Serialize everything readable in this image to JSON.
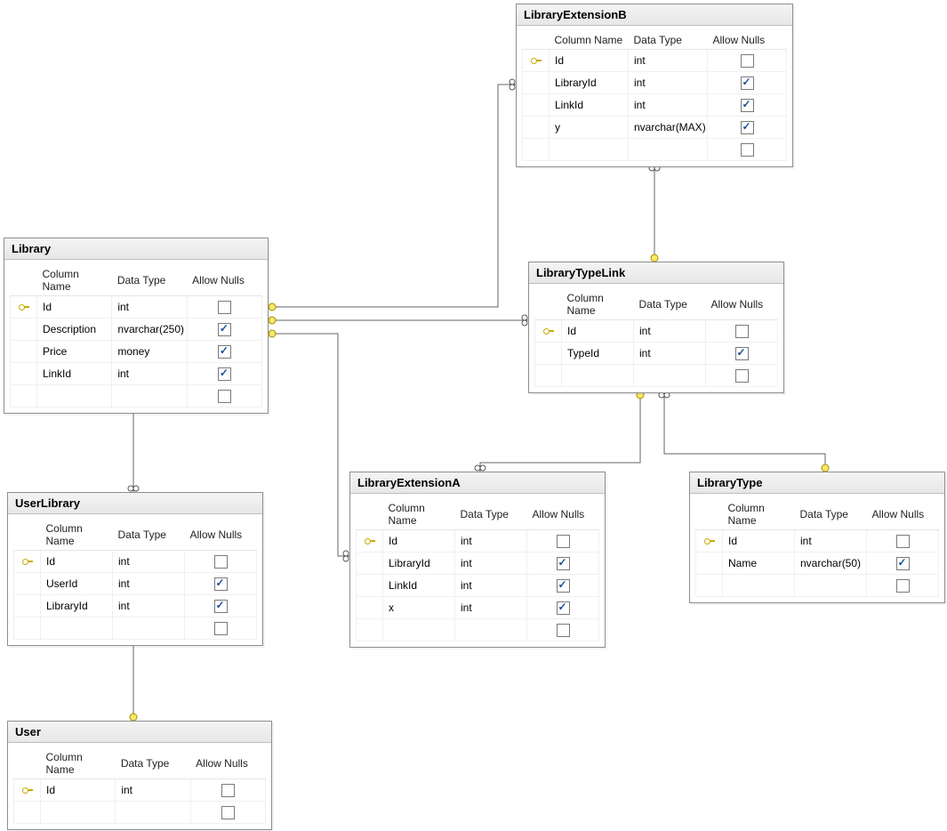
{
  "headers": {
    "column_name": "Column Name",
    "data_type": "Data Type",
    "allow_nulls": "Allow Nulls"
  },
  "tables": {
    "library": {
      "title": "Library",
      "columns": [
        {
          "name": "Id",
          "type": "int",
          "nullable": false,
          "pk": true
        },
        {
          "name": "Description",
          "type": "nvarchar(250)",
          "nullable": true,
          "pk": false
        },
        {
          "name": "Price",
          "type": "money",
          "nullable": true,
          "pk": false
        },
        {
          "name": "LinkId",
          "type": "int",
          "nullable": true,
          "pk": false
        }
      ]
    },
    "userlibrary": {
      "title": "UserLibrary",
      "columns": [
        {
          "name": "Id",
          "type": "int",
          "nullable": false,
          "pk": true
        },
        {
          "name": "UserId",
          "type": "int",
          "nullable": true,
          "pk": false
        },
        {
          "name": "LibraryId",
          "type": "int",
          "nullable": true,
          "pk": false
        }
      ]
    },
    "user": {
      "title": "User",
      "columns": [
        {
          "name": "Id",
          "type": "int",
          "nullable": false,
          "pk": true
        }
      ]
    },
    "libraryextensionb": {
      "title": "LibraryExtensionB",
      "columns": [
        {
          "name": "Id",
          "type": "int",
          "nullable": false,
          "pk": true
        },
        {
          "name": "LibraryId",
          "type": "int",
          "nullable": true,
          "pk": false
        },
        {
          "name": "LinkId",
          "type": "int",
          "nullable": true,
          "pk": false
        },
        {
          "name": "y",
          "type": "nvarchar(MAX)",
          "nullable": true,
          "pk": false
        }
      ]
    },
    "librarytypelink": {
      "title": "LibraryTypeLink",
      "columns": [
        {
          "name": "Id",
          "type": "int",
          "nullable": false,
          "pk": true
        },
        {
          "name": "TypeId",
          "type": "int",
          "nullable": true,
          "pk": false
        }
      ]
    },
    "libraryextensiona": {
      "title": "LibraryExtensionA",
      "columns": [
        {
          "name": "Id",
          "type": "int",
          "nullable": false,
          "pk": true
        },
        {
          "name": "LibraryId",
          "type": "int",
          "nullable": true,
          "pk": false
        },
        {
          "name": "LinkId",
          "type": "int",
          "nullable": true,
          "pk": false
        },
        {
          "name": "x",
          "type": "int",
          "nullable": true,
          "pk": false
        }
      ]
    },
    "librarytype": {
      "title": "LibraryType",
      "columns": [
        {
          "name": "Id",
          "type": "int",
          "nullable": false,
          "pk": true
        },
        {
          "name": "Name",
          "type": "nvarchar(50)",
          "nullable": true,
          "pk": false
        }
      ]
    }
  },
  "relationships": [
    {
      "from": "UserLibrary.LibraryId",
      "to": "Library.Id"
    },
    {
      "from": "UserLibrary.UserId",
      "to": "User.Id"
    },
    {
      "from": "Library.LinkId",
      "to": "LibraryTypeLink.Id"
    },
    {
      "from": "LibraryExtensionB.LibraryId",
      "to": "Library.Id"
    },
    {
      "from": "LibraryExtensionB.LinkId",
      "to": "LibraryTypeLink.Id"
    },
    {
      "from": "LibraryExtensionA.LibraryId",
      "to": "Library.Id"
    },
    {
      "from": "LibraryExtensionA.LinkId",
      "to": "LibraryTypeLink.Id"
    },
    {
      "from": "LibraryTypeLink.TypeId",
      "to": "LibraryType.Id"
    }
  ]
}
